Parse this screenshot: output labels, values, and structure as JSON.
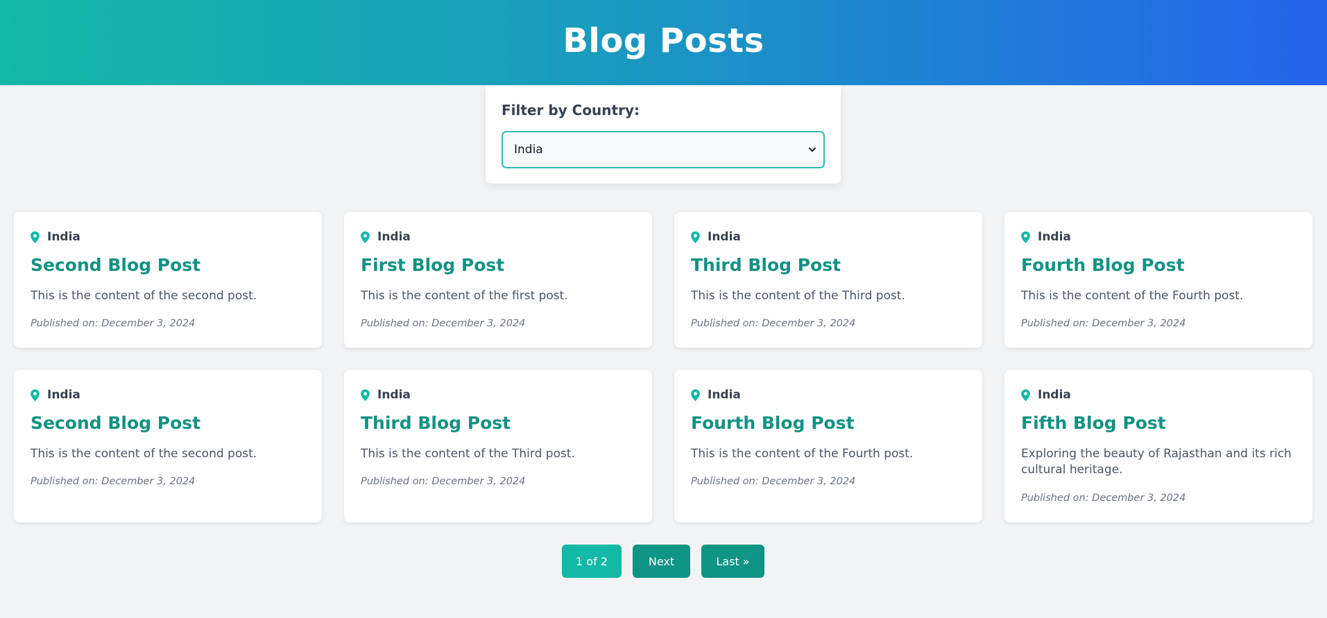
{
  "page": {
    "title": "Blog Posts"
  },
  "filter": {
    "label": "Filter by Country:",
    "selected": "India"
  },
  "posts": [
    {
      "country": "India",
      "title": "Second Blog Post",
      "content": "This is the content of the second post.",
      "date": "Published on: December 3, 2024"
    },
    {
      "country": "India",
      "title": "First Blog Post",
      "content": "This is the content of the first post.",
      "date": "Published on: December 3, 2024"
    },
    {
      "country": "India",
      "title": "Third Blog Post",
      "content": "This is the content of the Third post.",
      "date": "Published on: December 3, 2024"
    },
    {
      "country": "India",
      "title": "Fourth Blog Post",
      "content": "This is the content of the Fourth post.",
      "date": "Published on: December 3, 2024"
    },
    {
      "country": "India",
      "title": "Second Blog Post",
      "content": "This is the content of the second post.",
      "date": "Published on: December 3, 2024"
    },
    {
      "country": "India",
      "title": "Third Blog Post",
      "content": "This is the content of the Third post.",
      "date": "Published on: December 3, 2024"
    },
    {
      "country": "India",
      "title": "Fourth Blog Post",
      "content": "This is the content of the Fourth post.",
      "date": "Published on: December 3, 2024"
    },
    {
      "country": "India",
      "title": "Fifth Blog Post",
      "content": "Exploring the beauty of Rajasthan and its rich cultural heritage.",
      "date": "Published on: December 3, 2024"
    }
  ],
  "pagination": {
    "current": "1 of 2",
    "next": "Next",
    "last": "Last »"
  },
  "icons": {
    "location": "location-pin-icon",
    "dropdown": "chevron-down-icon"
  },
  "colors": {
    "accent": "#14b8a6",
    "accent_dark": "#0f9486",
    "title": "#129283",
    "header_start": "#14b8a6",
    "header_end": "#2563eb"
  }
}
